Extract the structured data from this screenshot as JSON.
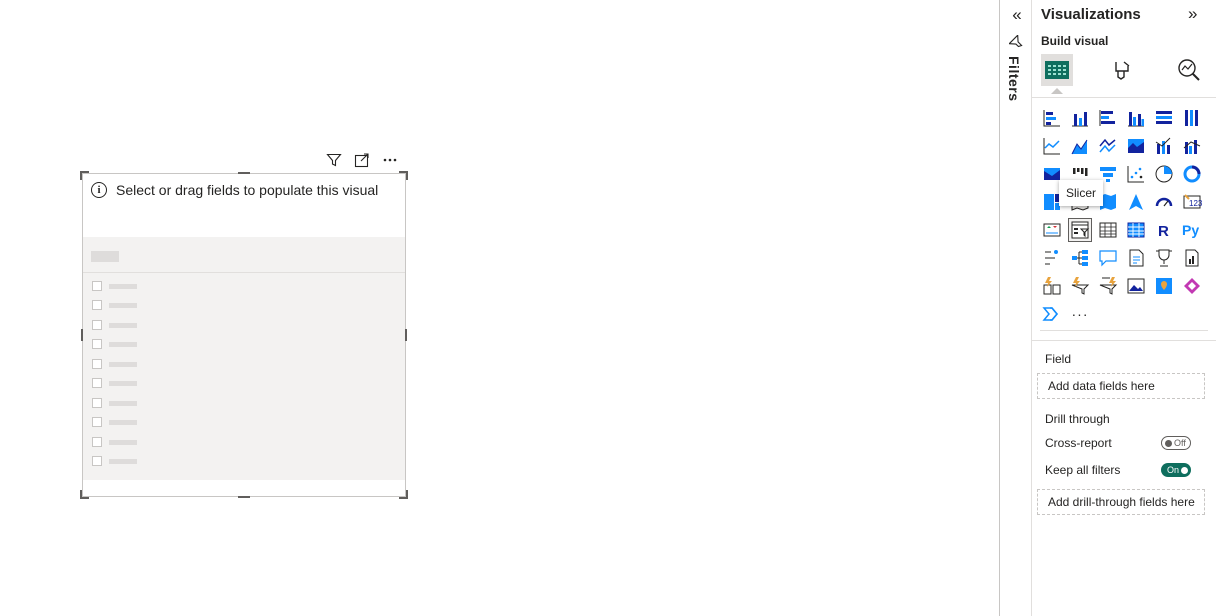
{
  "visual": {
    "placeholder_text": "Select or drag fields to populate this visual",
    "list_items": 10
  },
  "filters": {
    "label": "Filters"
  },
  "visualizations": {
    "title": "Visualizations",
    "build_visual_label": "Build visual",
    "tooltip": "Slicer",
    "more_label": "···",
    "field_label": "Field",
    "field_well": "Add data fields here",
    "drill_through_label": "Drill through",
    "cross_report_label": "Cross-report",
    "cross_report_state": "Off",
    "keep_filters_label": "Keep all filters",
    "keep_filters_state": "On",
    "drill_well": "Add drill-through fields here",
    "icons": [
      [
        "stacked-bar-chart-icon",
        "stacked-column-chart-icon",
        "clustered-bar-chart-icon",
        "clustered-column-chart-icon",
        "100-stacked-bar-chart-icon",
        "100-stacked-column-chart-icon"
      ],
      [
        "line-chart-icon",
        "area-chart-icon",
        "stacked-area-chart-icon",
        "100-stacked-area-chart-icon",
        "line-and-stacked-column-chart-icon",
        "line-and-clustered-column-chart-icon"
      ],
      [
        "ribbon-chart-icon",
        "waterfall-chart-icon",
        "funnel-icon",
        "scatter-chart-icon",
        "pie-chart-icon",
        "donut-chart-icon"
      ],
      [
        "treemap-icon",
        "map-icon",
        "filled-map-icon",
        "azure-map-icon",
        "gauge-icon",
        "card-icon"
      ],
      [
        "kpi-icon",
        "slicer-icon",
        "table-icon",
        "matrix-icon",
        "r-visual-icon",
        "python-visual-icon"
      ],
      [
        "key-influencers-icon",
        "decomposition-tree-icon",
        "qa-icon",
        "smart-narrative-icon",
        "goals-icon",
        "paginated-report-icon"
      ],
      [
        "power-apps-icon",
        "power-automate-icon",
        "narrative-icon",
        "image-icon",
        "arcgis-map-icon",
        "power-apps-visual-icon"
      ],
      [
        "chevron-visual-icon",
        "more-visuals-icon"
      ]
    ]
  },
  "colors": {
    "accent": "#118dff",
    "dark_blue": "#12239e",
    "toggle_on": "#0e6e5e",
    "border": "#c8c6c4"
  }
}
